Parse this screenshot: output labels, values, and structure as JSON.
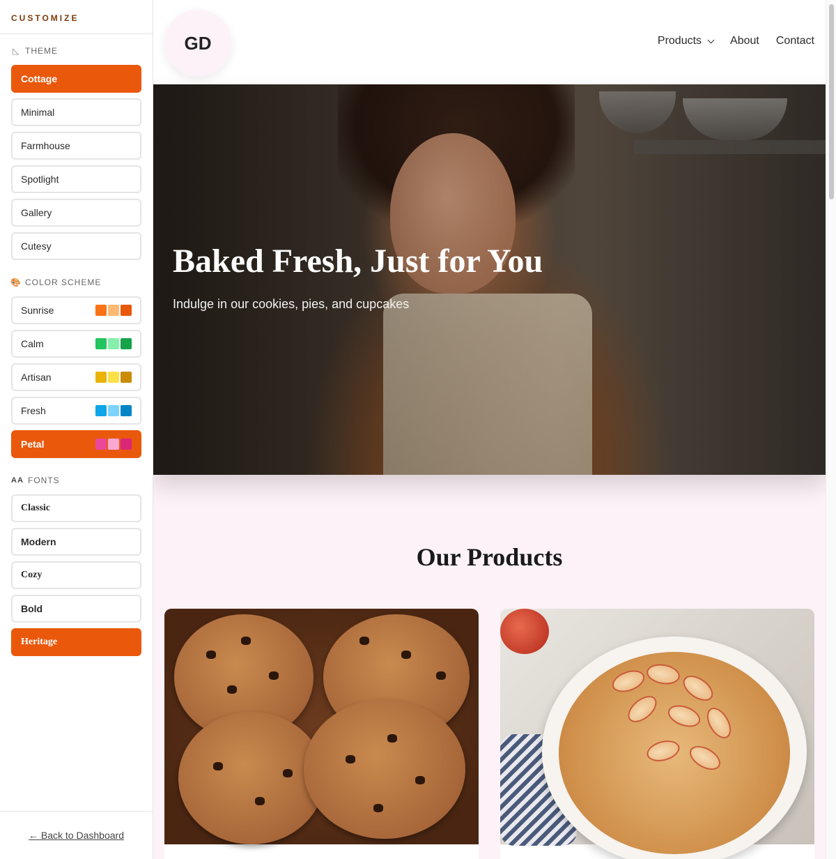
{
  "sidebar": {
    "title": "CUSTOMIZE",
    "theme_label": "THEME",
    "themes": [
      {
        "label": "Cottage",
        "active": true
      },
      {
        "label": "Minimal",
        "active": false
      },
      {
        "label": "Farmhouse",
        "active": false
      },
      {
        "label": "Spotlight",
        "active": false
      },
      {
        "label": "Gallery",
        "active": false
      },
      {
        "label": "Cutesy",
        "active": false
      }
    ],
    "color_label": "COLOR SCHEME",
    "colors": [
      {
        "label": "Sunrise",
        "active": false,
        "swatches": [
          "#f97316",
          "#fdba74",
          "#ea580c"
        ]
      },
      {
        "label": "Calm",
        "active": false,
        "swatches": [
          "#22c55e",
          "#86efac",
          "#16a34a"
        ]
      },
      {
        "label": "Artisan",
        "active": false,
        "swatches": [
          "#eab308",
          "#fde047",
          "#ca8a04"
        ]
      },
      {
        "label": "Fresh",
        "active": false,
        "swatches": [
          "#0ea5e9",
          "#7dd3fc",
          "#0284c7"
        ]
      },
      {
        "label": "Petal",
        "active": true,
        "swatches": [
          "#ec4899",
          "#f9a8d4",
          "#db2777"
        ]
      }
    ],
    "fonts_label": "FONTS",
    "fonts_icon_text": "AA",
    "fonts": [
      {
        "label": "Classic",
        "active": false,
        "serif": true
      },
      {
        "label": "Modern",
        "active": false,
        "serif": false
      },
      {
        "label": "Cozy",
        "active": false,
        "serif": true
      },
      {
        "label": "Bold",
        "active": false,
        "serif": false
      },
      {
        "label": "Heritage",
        "active": true,
        "serif": true
      }
    ],
    "back_link": "← Back to Dashboard",
    "accent": "#ea580c"
  },
  "site": {
    "logo_text": "GD",
    "nav": {
      "products": "Products",
      "about": "About",
      "contact": "Contact"
    },
    "hero": {
      "title": "Baked Fresh, Just for You",
      "subtitle": "Indulge in our cookies, pies, and cupcakes"
    },
    "products_title": "Our Products",
    "background": "#fdf2f8"
  }
}
